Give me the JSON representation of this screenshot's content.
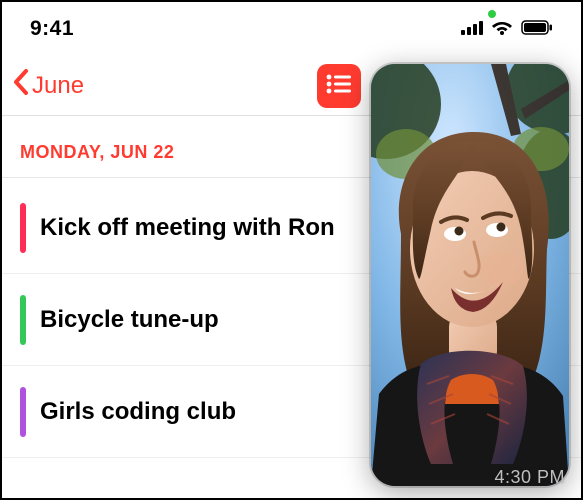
{
  "status_bar": {
    "time": "9:41",
    "camera_indicator": true
  },
  "nav": {
    "back_label": "June",
    "list_button_icon": "list-bullet-icon"
  },
  "day_header": "MONDAY, JUN 22",
  "events": [
    {
      "title": "Kick off meeting with Ron",
      "color": "#ff2d55"
    },
    {
      "title": "Bicycle tune-up",
      "color": "#34c759"
    },
    {
      "title": "Girls coding club",
      "color": "#af52de"
    }
  ],
  "pip": {
    "kind": "facetime-video",
    "subject": "person-looking-up",
    "overlay_time": "4:30 PM"
  }
}
